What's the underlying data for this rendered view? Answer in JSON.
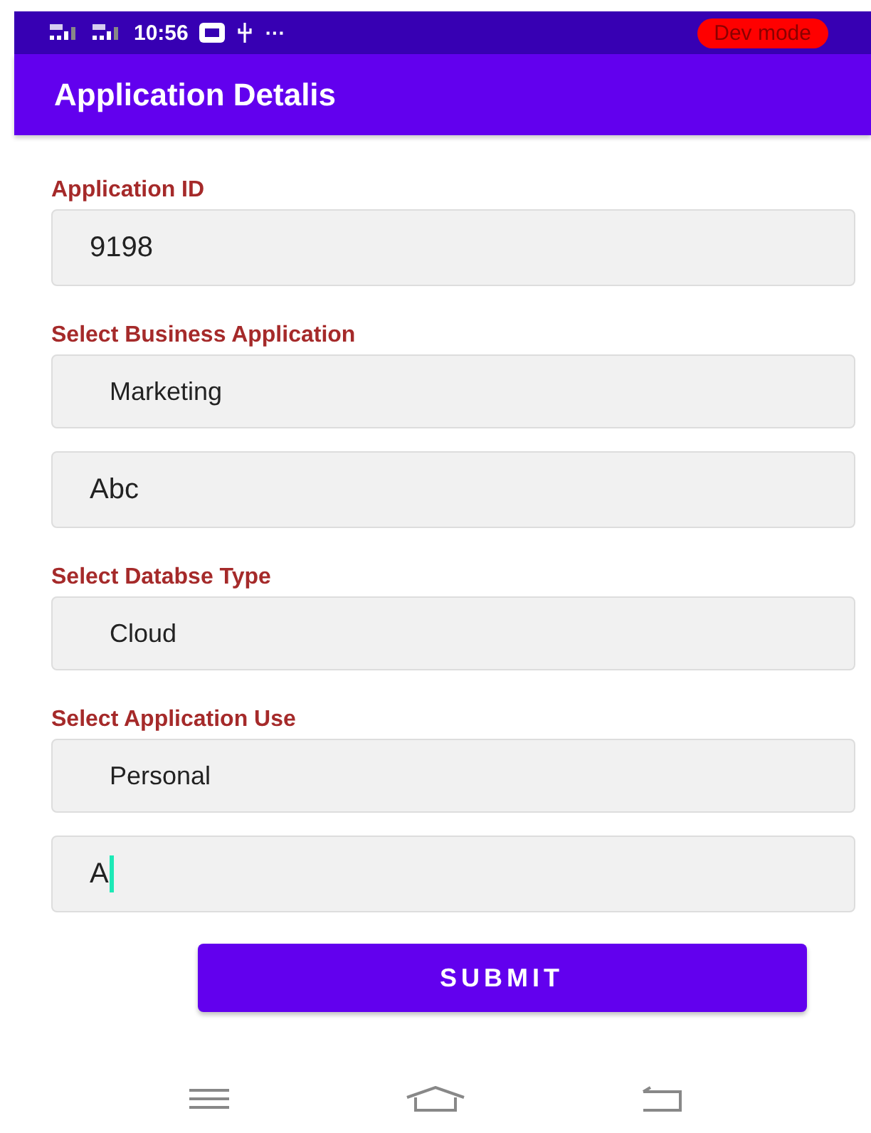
{
  "status_bar": {
    "time": "10:56",
    "more": "···",
    "badge": "Dev mode"
  },
  "app_bar": {
    "title": "Application Detalis"
  },
  "form": [
    {
      "label": "Application ID",
      "kind": "input",
      "value": "9198",
      "focused": false
    },
    {
      "label": "Select Business Application",
      "kind": "select",
      "value": "Marketing",
      "focused": false
    },
    {
      "kind": "input",
      "value": "Abc",
      "focused": false
    },
    {
      "label": "Select Databse Type",
      "kind": "select",
      "value": "Cloud",
      "focused": false
    },
    {
      "label": "Select Application Use",
      "kind": "select",
      "value": "Personal",
      "focused": false
    },
    {
      "kind": "input",
      "value": "A",
      "focused": true
    }
  ],
  "submit": {
    "label": "SUBMIT"
  }
}
